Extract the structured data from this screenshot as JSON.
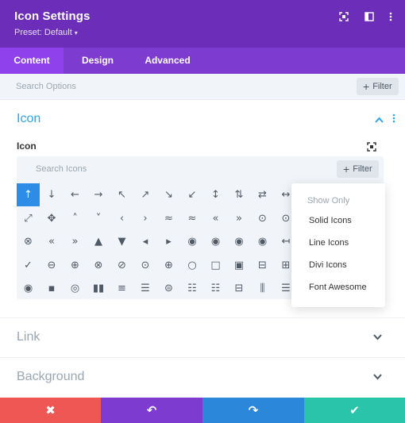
{
  "header": {
    "title": "Icon Settings",
    "preset_label": "Preset: Default",
    "bg_color": "#6c2eb9"
  },
  "tabs": [
    {
      "label": "Content",
      "active": true
    },
    {
      "label": "Design",
      "active": false
    },
    {
      "label": "Advanced",
      "active": false
    }
  ],
  "search": {
    "placeholder": "Search Options",
    "filter_label": "Filter"
  },
  "icon_section": {
    "title": "Icon",
    "field_label": "Icon",
    "search_placeholder": "Search Icons",
    "filter_label": "Filter",
    "icon_rows": [
      [
        "↑",
        "↓",
        "←",
        "→",
        "↖",
        "↗",
        "↘",
        "↙",
        "↕",
        "⇅",
        "⇄",
        "↔"
      ],
      [
        "⤢",
        "✥",
        "˄",
        "˅",
        "‹",
        "›",
        "≈",
        "≈",
        "«",
        "»",
        "⊙",
        "⊙"
      ],
      [
        "⊗",
        "«",
        "»",
        "▲",
        "▼",
        "◂",
        "▸",
        "◉",
        "◉",
        "◉",
        "◉",
        "↤"
      ],
      [
        "✓",
        "⊖",
        "⊕",
        "⊗",
        "⊘",
        "⊙",
        "⊕",
        "○",
        "□",
        "▣",
        "⊟",
        "⊞"
      ],
      [
        "◉",
        "▪",
        "◎",
        "▮▮",
        "≡",
        "☰",
        "⊜",
        "☷",
        "☷",
        "⊟",
        "⫼",
        "☰"
      ]
    ],
    "selected_icon": "↑",
    "dropdown": {
      "heading": "Show Only",
      "options": [
        "Solid Icons",
        "Line Icons",
        "Divi Icons",
        "Font Awesome"
      ]
    }
  },
  "collapsed_sections": [
    {
      "title": "Link"
    },
    {
      "title": "Background"
    }
  ],
  "footer": {
    "buttons": [
      {
        "icon": "close-icon",
        "glyph": "✖",
        "color": "#ee5754"
      },
      {
        "icon": "undo-icon",
        "glyph": "↶",
        "color": "#7e3bd0"
      },
      {
        "icon": "redo-icon",
        "glyph": "↷",
        "color": "#2b87da"
      },
      {
        "icon": "check-icon",
        "glyph": "✔",
        "color": "#29c4a9"
      }
    ]
  },
  "colors": {
    "accent": "#2ea3f2",
    "tab_bar": "#7e3bd0",
    "tab_active": "#8f42ec",
    "selected_icon_bg": "#2e8ce6"
  }
}
